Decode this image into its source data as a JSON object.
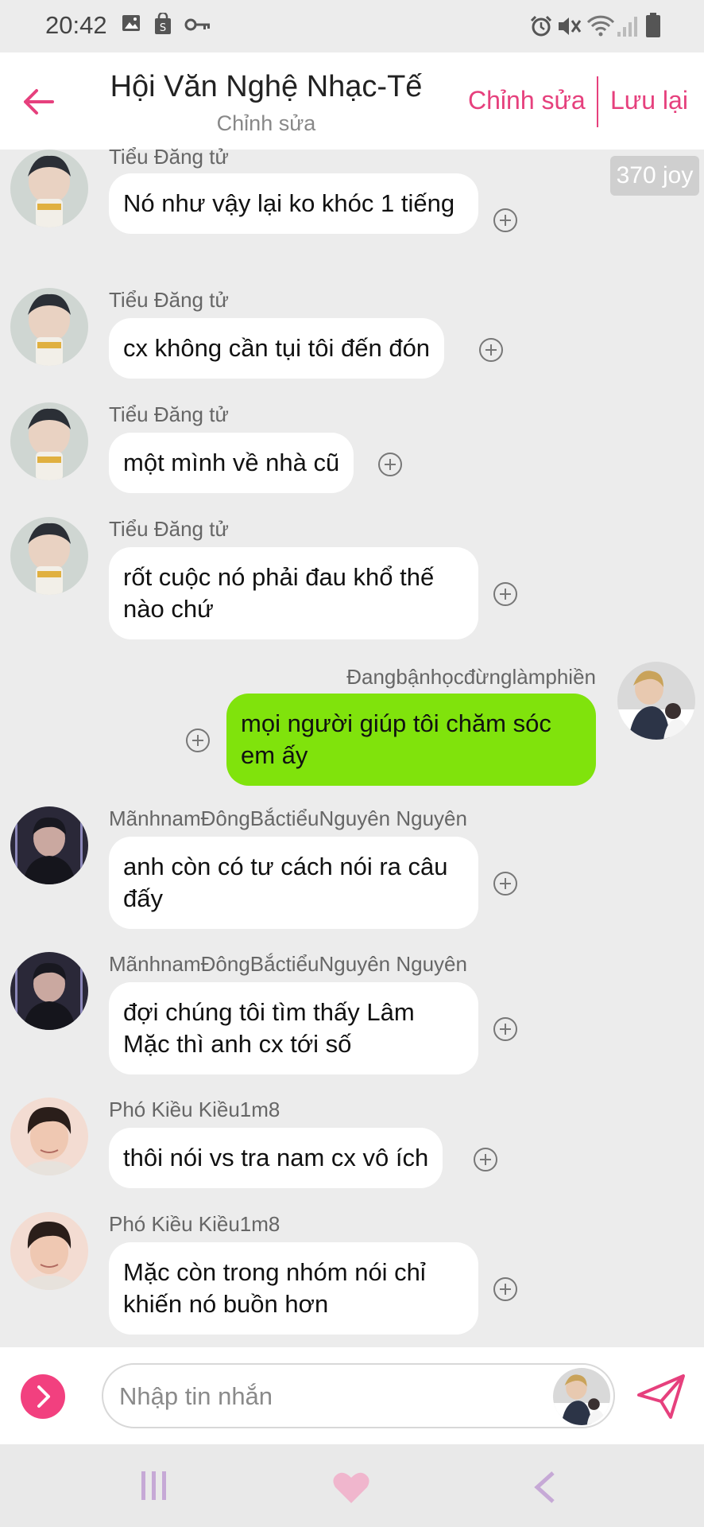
{
  "status": {
    "time": "20:42"
  },
  "header": {
    "title": "Hội Văn Nghệ Nhạc-Tế",
    "subtitle": "Chỉnh sửa",
    "edit_label": "Chỉnh sửa",
    "save_label": "Lưu lại"
  },
  "joy_badge": "370 joy",
  "messages": [
    {
      "sender": "Tiểu Đăng tử",
      "text": "Nó như vậy lại ko khóc 1 tiếng",
      "direction": "in",
      "avatar": "avatar-1"
    },
    {
      "sender": "Tiểu Đăng tử",
      "text": "cx không cần tụi tôi đến đón",
      "direction": "in",
      "avatar": "avatar-1"
    },
    {
      "sender": "Tiểu Đăng tử",
      "text": "một mình về nhà cũ",
      "direction": "in",
      "avatar": "avatar-1"
    },
    {
      "sender": "Tiểu Đăng tử",
      "text": "rốt cuộc nó phải đau khổ thế nào chứ",
      "direction": "in",
      "avatar": "avatar-1"
    },
    {
      "sender": "Đangbậnhọcđừnglàmphiền",
      "text": "mọi người giúp tôi chăm sóc em ấy",
      "direction": "out",
      "avatar": "avatar-self"
    },
    {
      "sender": "MãnhnamĐôngBắctiểuNguyên Nguyên",
      "text": "anh còn có tư cách nói ra câu đấy",
      "direction": "in",
      "avatar": "avatar-2"
    },
    {
      "sender": "MãnhnamĐôngBắctiểuNguyên Nguyên",
      "text": "đợi chúng tôi tìm thấy Lâm Mặc thì anh cx tới số",
      "direction": "in",
      "avatar": "avatar-2"
    },
    {
      "sender": "Phó Kiều Kiều1m8",
      "text": "thôi nói vs tra nam cx vô ích",
      "direction": "in",
      "avatar": "avatar-3"
    },
    {
      "sender": "Phó Kiều Kiều1m8",
      "text": "Mặc còn trong nhóm nói chỉ khiến nó buồn hơn",
      "direction": "in",
      "avatar": "avatar-3"
    }
  ],
  "composer": {
    "placeholder": "Nhập tin nhắn",
    "value": ""
  },
  "colors": {
    "accent": "#e6407d",
    "outgoing_bubble": "#80e30c",
    "incoming_bubble": "#ffffff",
    "background": "#ececec"
  }
}
